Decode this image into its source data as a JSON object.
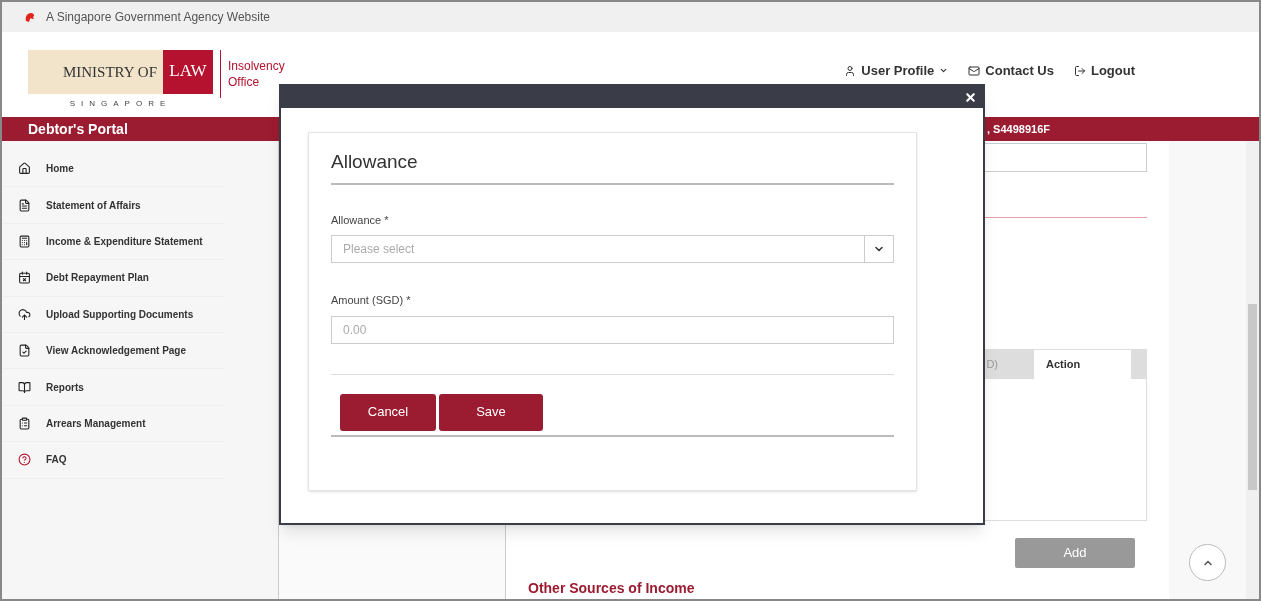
{
  "gov_banner": {
    "text": "A Singapore Government Agency Website"
  },
  "logo": {
    "ministry": "MINISTRY OF",
    "law": "LAW",
    "country": "SINGAPORE",
    "office": "Insolvency Office"
  },
  "nav": [
    {
      "label": "User Profile",
      "dropdown": true
    },
    {
      "label": "Contact Us",
      "dropdown": false
    },
    {
      "label": "Logout",
      "dropdown": false
    }
  ],
  "portal_bar": {
    "title": "Debtor's Portal",
    "user": ", S4498916F"
  },
  "sidebar": {
    "items": [
      {
        "label": "Home"
      },
      {
        "label": "Statement of Affairs"
      },
      {
        "label": "Income & Expenditure Statement"
      },
      {
        "label": "Debt Repayment Plan"
      },
      {
        "label": "Upload Supporting Documents"
      },
      {
        "label": "View Acknowledgement Page"
      },
      {
        "label": "Reports"
      },
      {
        "label": "Arrears Management"
      },
      {
        "label": "FAQ"
      }
    ]
  },
  "content": {
    "table": {
      "columns": [
        "D)",
        "Action"
      ]
    },
    "add_button": "Add",
    "section_title": "Other Sources of Income"
  },
  "modal": {
    "title": "Allowance",
    "fields": [
      {
        "kind": "select",
        "label": "Allowance *",
        "placeholder": "Please select"
      },
      {
        "kind": "input",
        "label": "Amount (SGD) *",
        "placeholder": "0.00"
      }
    ],
    "buttons": [
      "Cancel",
      "Save"
    ]
  }
}
